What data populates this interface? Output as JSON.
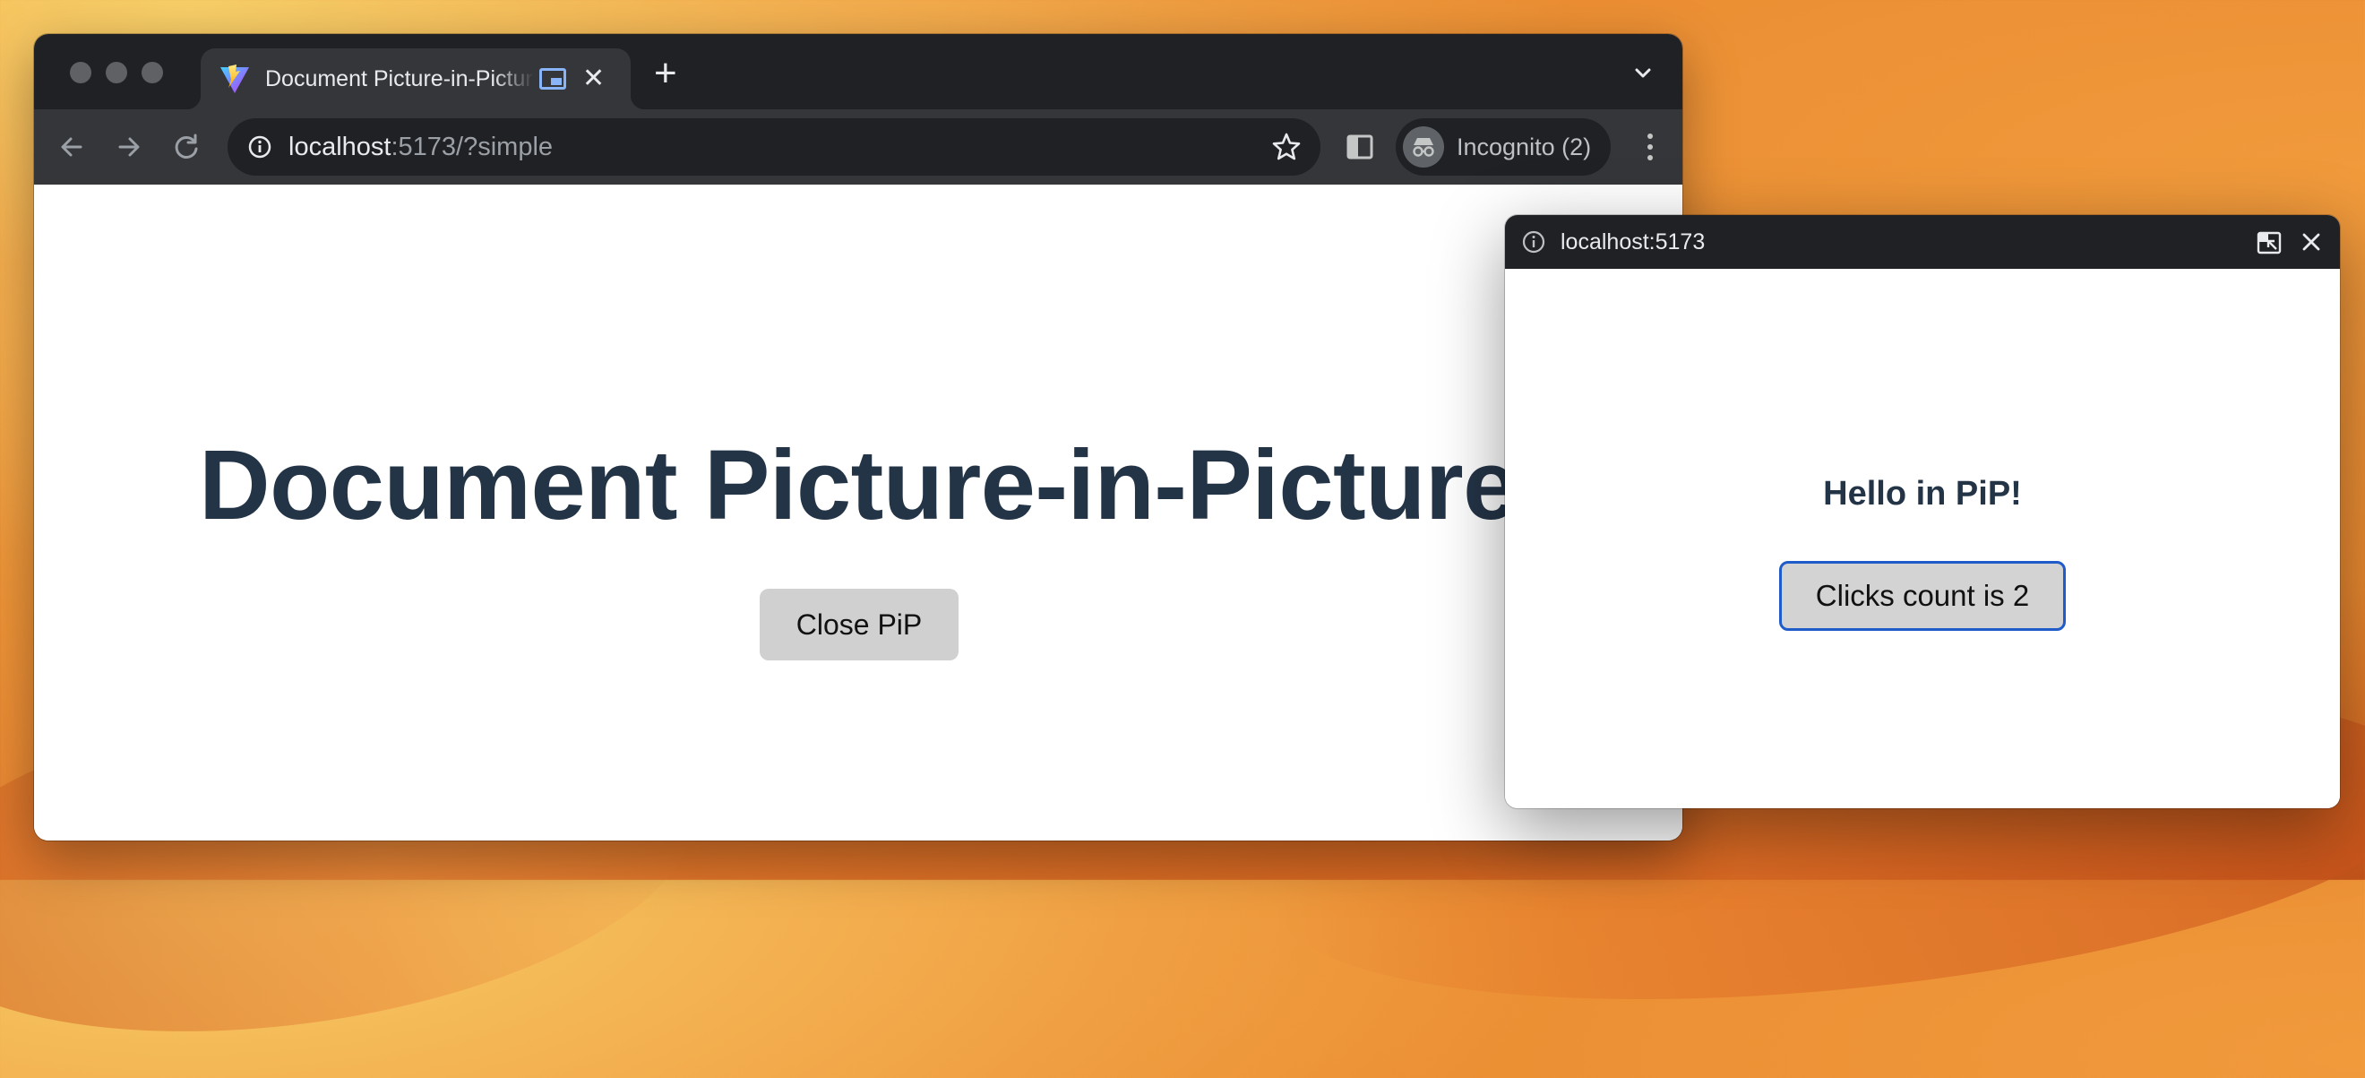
{
  "browser": {
    "tab": {
      "title": "Document Picture-in-Picture",
      "close_glyph": "✕"
    },
    "new_tab_glyph": "+",
    "address": {
      "host": "localhost",
      "rest": ":5173/?simple"
    },
    "profile": {
      "label": "Incognito (2)"
    }
  },
  "page": {
    "heading": "Document Picture-in-Picture",
    "close_pip_label": "Close PiP"
  },
  "pip_window": {
    "url": "localhost:5173",
    "hello": "Hello in PiP!",
    "clicks_label": "Clicks count is 2"
  },
  "colors": {
    "heading": "#243447",
    "button_bg": "#d0d0d0",
    "focus_ring": "#1f5cc9",
    "chrome_dark": "#202124",
    "chrome_toolbar": "#35363a"
  },
  "icons": [
    "favicon-vite-icon",
    "pip-indicator-icon",
    "back-arrow-icon",
    "forward-arrow-icon",
    "reload-icon",
    "info-icon",
    "star-icon",
    "side-panel-icon",
    "incognito-icon",
    "menu-dots-icon",
    "back-to-tab-icon",
    "close-icon"
  ]
}
